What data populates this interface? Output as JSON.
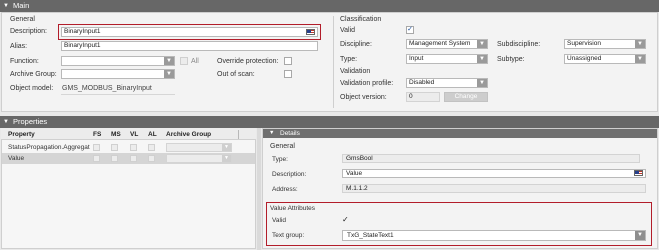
{
  "main_header": {
    "title": "Main"
  },
  "general": {
    "title": "General",
    "description_label": "Description:",
    "description_value": "BinaryInput1",
    "alias_label": "Alias:",
    "alias_value": "BinaryInput1",
    "function_label": "Function:",
    "function_value": "",
    "all_label": "All",
    "all_checked": false,
    "archive_group_label": "Archive Group:",
    "archive_group_value": "",
    "object_model_label": "Object model:",
    "object_model_value": "GMS_MODBUS_BinaryInput",
    "override_label": "Override protection:",
    "out_of_scan_label": "Out of scan:"
  },
  "classification": {
    "title": "Classification",
    "valid_label": "Valid",
    "valid_checked": true,
    "discipline_label": "Discipline:",
    "discipline_value": "Management System",
    "subdiscipline_label": "Subdiscipline:",
    "subdiscipline_value": "Supervision",
    "type_label": "Type:",
    "type_value": "Input",
    "subtype_label": "Subtype:",
    "subtype_value": "Unassigned"
  },
  "validation": {
    "title": "Validation",
    "profile_label": "Validation profile:",
    "profile_value": "Disabled",
    "object_version_label": "Object version:",
    "object_version_value": "0",
    "change_button": "Change"
  },
  "properties_header": {
    "title": "Properties"
  },
  "properties_table": {
    "columns": [
      "Property",
      "FS",
      "MS",
      "VL",
      "AL",
      "Archive Group"
    ],
    "rows": [
      {
        "property": "StatusPropagation.Aggregat"
      },
      {
        "property": "Value"
      }
    ]
  },
  "details": {
    "title": "Details",
    "general_title": "General",
    "type_label": "Type:",
    "type_value": "GmsBool",
    "description_label": "Description:",
    "description_value": "Value",
    "address_label": "Address:",
    "address_value": "M.1.1.2",
    "value_attributes_title": "Value Attributes",
    "valid_label": "Valid",
    "valid_mark": "✓",
    "text_group_label": "Text group:",
    "text_group_value": "TxG_StateText1"
  },
  "icons": {
    "collapse": "triangle-down-icon",
    "dropdown": "chevron-down-icon",
    "language": "us-flag-icon",
    "checkmark": "check-icon"
  },
  "colors": {
    "header_bg": "#676767",
    "highlight_border": "#b21d2a",
    "checkmark": "#1b4f9c"
  }
}
